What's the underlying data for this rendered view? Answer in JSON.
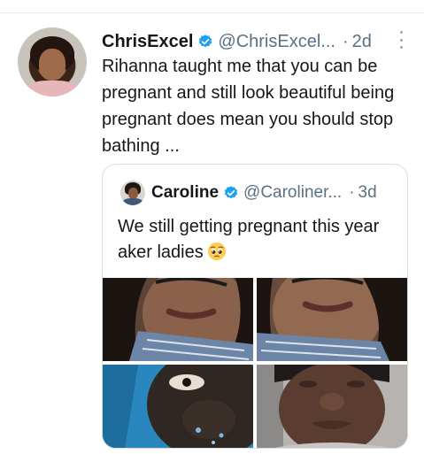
{
  "tweet": {
    "author_name": "ChrisExcel",
    "handle": "@ChrisExcel...",
    "separator": "·",
    "time": "2d",
    "text": "Rihanna taught me that you can be pregnant and still look beautiful being pregnant does mean you should stop bathing ...",
    "verified_color": "#1da1f2"
  },
  "quoted_tweet": {
    "author_name": "Caroline",
    "handle": "@Caroliner...",
    "separator": "·",
    "time": "3d",
    "text": "We still getting pregnant this year aker ladies",
    "emoji_name": "pleading-face"
  },
  "colors": {
    "secondary_text": "#5b7083",
    "border": "#d5dde3"
  }
}
